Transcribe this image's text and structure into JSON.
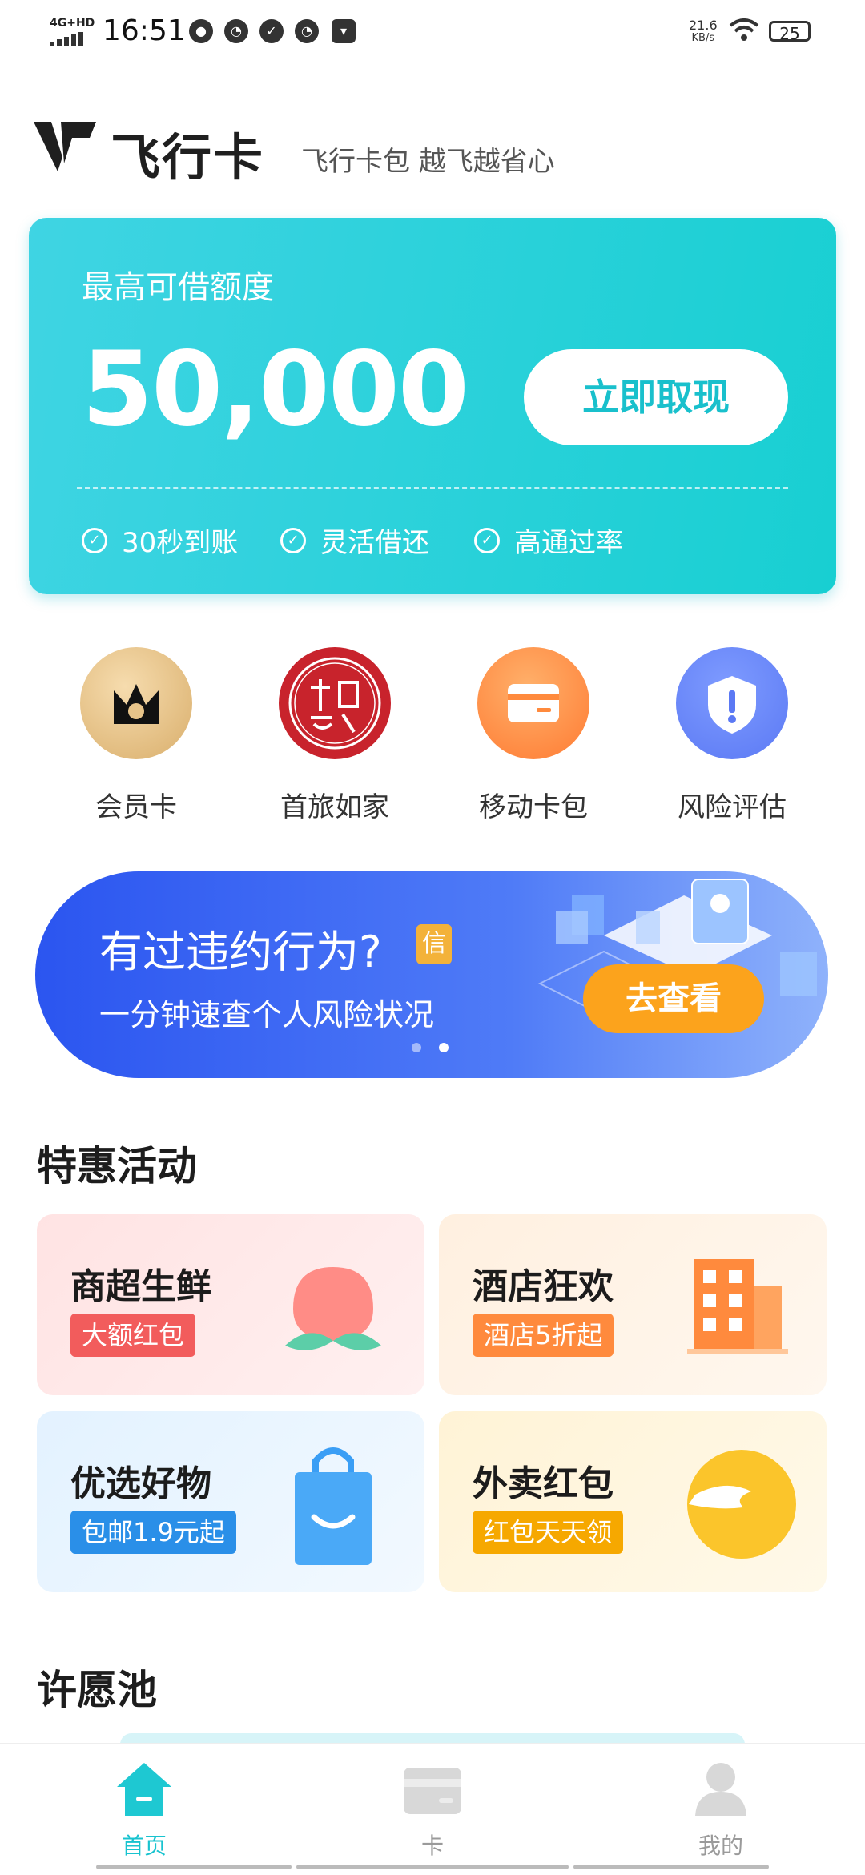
{
  "status_bar": {
    "network": "4G+HD",
    "time": "16:51",
    "speed_value": "21.6",
    "speed_unit": "KB/s",
    "battery": "25"
  },
  "header": {
    "brand": "飞行卡",
    "slogan": "飞行卡包 越飞越省心"
  },
  "hero": {
    "label": "最高可借额度",
    "amount": "50,000",
    "button": "立即取现",
    "features": [
      "30秒到账",
      "灵活借还",
      "高通过率"
    ]
  },
  "quick_icons": [
    {
      "label": "会员卡",
      "icon": "crown-icon"
    },
    {
      "label": "首旅如家",
      "icon": "seal-icon"
    },
    {
      "label": "移动卡包",
      "icon": "card-icon"
    },
    {
      "label": "风险评估",
      "icon": "shield-icon"
    }
  ],
  "banner": {
    "title": "有过违约行为?",
    "badge": "信",
    "subtitle": "一分钟速查个人风险状况",
    "button": "去查看"
  },
  "deals": {
    "title": "特惠活动",
    "items": [
      {
        "title": "商超生鲜",
        "tag": "大额红包",
        "icon": "peach-icon"
      },
      {
        "title": "酒店狂欢",
        "tag": "酒店5折起",
        "icon": "building-icon"
      },
      {
        "title": "优选好物",
        "tag": "包邮1.9元起",
        "icon": "shopping-bag-icon"
      },
      {
        "title": "外卖红包",
        "tag": "红包天天领",
        "icon": "delivery-icon"
      }
    ]
  },
  "wishpool": {
    "title": "许愿池"
  },
  "tabbar": {
    "items": [
      {
        "label": "首页",
        "icon": "home-icon",
        "active": true
      },
      {
        "label": "卡",
        "icon": "card-icon",
        "active": false
      },
      {
        "label": "我的",
        "icon": "user-icon",
        "active": false
      }
    ]
  },
  "colors": {
    "accent": "#19c0cc",
    "banner_blue": "#2b55f0",
    "banner_button": "#fca31c"
  }
}
